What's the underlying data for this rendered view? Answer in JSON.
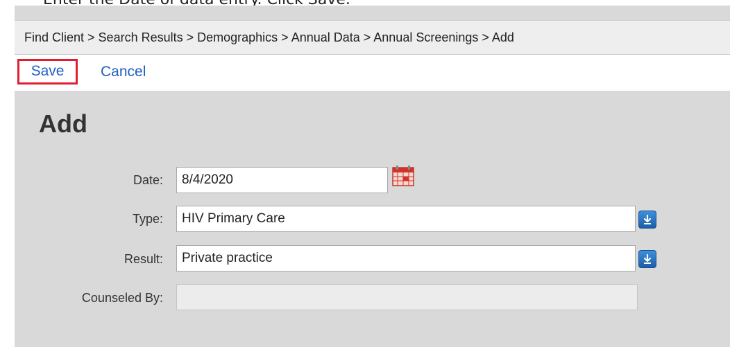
{
  "caption": "Enter the Date of data entry. Click Save.",
  "breadcrumb": "Find Client > Search Results > Demographics > Annual Data > Annual Screenings > Add",
  "toolbar": {
    "save_label": "Save",
    "cancel_label": "Cancel"
  },
  "page_title": "Add",
  "form": {
    "date": {
      "label": "Date:",
      "value": "8/4/2020"
    },
    "type": {
      "label": "Type:",
      "value": "HIV Primary Care"
    },
    "result": {
      "label": "Result:",
      "value": "Private practice"
    },
    "counseled_by": {
      "label": "Counseled By:",
      "value": ""
    }
  },
  "icons": {
    "calendar": "calendar-icon",
    "dropdown": "download-arrow-icon"
  },
  "colors": {
    "link": "#1f5fc4",
    "highlight": "#e01e2e",
    "background": "#d9d9d9",
    "dropdown": "#2a72c2"
  }
}
